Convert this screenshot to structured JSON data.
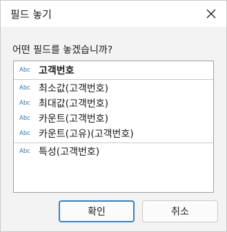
{
  "window": {
    "title": "필드 놓기",
    "close_icon": "close-icon"
  },
  "prompt": "어떤 필드를 놓겠습니까?",
  "list": {
    "type_label": "Abc",
    "groups": [
      {
        "items": [
          "고객번호"
        ]
      },
      {
        "items": [
          "최소값(고객번호)",
          "최대값(고객번호)",
          "카운트(고객번호)",
          "카운트(고유)(고객번호)"
        ]
      },
      {
        "items": [
          "특성(고객번호)"
        ]
      }
    ]
  },
  "buttons": {
    "ok": "확인",
    "cancel": "취소"
  },
  "colors": {
    "accent": "#3a7fc1",
    "type_tag": "#2e6ea8"
  }
}
